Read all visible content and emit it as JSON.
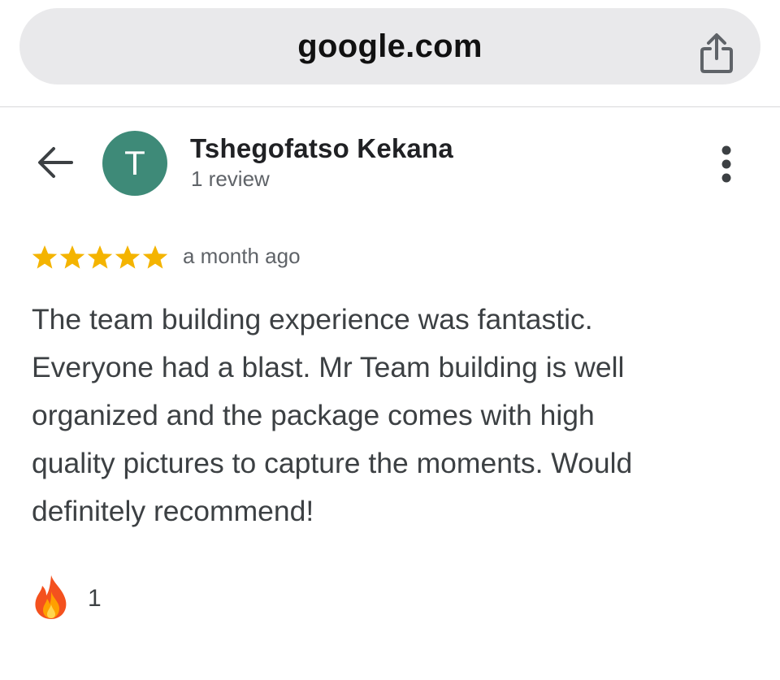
{
  "browser": {
    "url": "google.com",
    "share_icon": "share-icon"
  },
  "header": {
    "back_icon": "arrow-left-icon",
    "avatar_initial": "T",
    "avatar_color": "#3e8a78",
    "reviewer_name": "Tshegofatso Kekana",
    "reviewer_meta": "1 review",
    "more_icon": "more-vertical-icon"
  },
  "review": {
    "rating": 5,
    "rating_max": 5,
    "star_color": "#f4b400",
    "time": "a month ago",
    "text": "The team building experience was fantastic.\nEveryone had a blast. Mr Team building is well\norganized and the package comes with high\nquality pictures to capture the moments. Would\ndefinitely recommend!"
  },
  "reaction": {
    "icon": "fire-icon",
    "count": "1"
  }
}
